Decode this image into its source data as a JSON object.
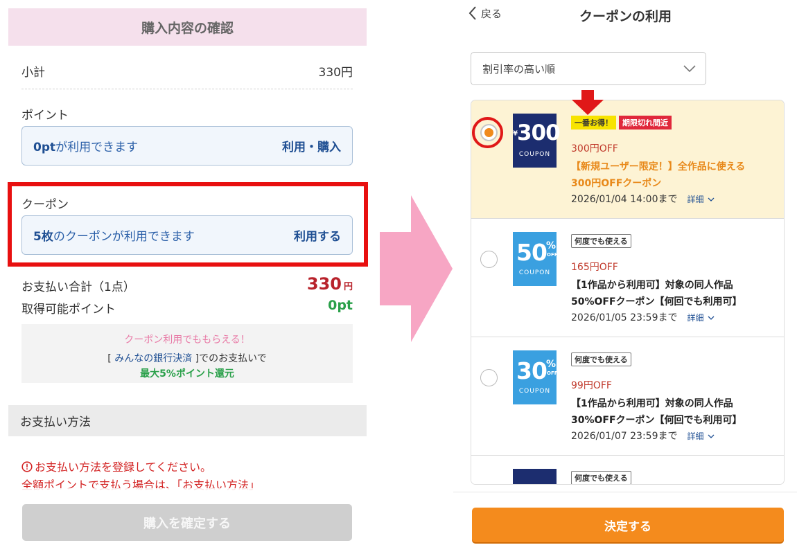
{
  "left": {
    "header_title": "購入内容の確認",
    "subtotal_label": "小計",
    "subtotal_value": "330円",
    "points_label": "ポイント",
    "points_box": {
      "amount": "0pt",
      "text": "が利用できます",
      "action": "利用・購入"
    },
    "coupon_label": "クーポン",
    "coupon_box": {
      "amount": "5枚",
      "text": "のクーポンが利用できます",
      "action": "利用する"
    },
    "total_label": "お支払い合計（1点）",
    "total_value": "330",
    "total_unit": "円",
    "earn_label": "取得可能ポイント",
    "earn_value": "0pt",
    "promo": {
      "line1": "クーポン利用でももらえる！",
      "line2_pre": "[ ",
      "line2_link": "みんなの銀行決済",
      "line2_post": " ]でのお支払いで",
      "line3": "最大5%ポイント還元"
    },
    "payment_method_label": "お支払い方法",
    "warning_line1": "お支払い方法を登録してください。",
    "warning_line2": "全額ポイントで支払う場合は、「お支払い方法」",
    "confirm_button": "購入を確定する"
  },
  "right": {
    "back_label": "戻る",
    "title": "クーポンの利用",
    "sort_selected": "割引率の高い順",
    "coupons": [
      {
        "selected": true,
        "image": {
          "style": "navy",
          "yen": "¥",
          "amount": "300",
          "word": "COUPON"
        },
        "badges": [
          {
            "type": "yellow",
            "text": "一番お得！"
          },
          {
            "type": "red",
            "text": "期限切れ間近"
          }
        ],
        "discount": "300円OFF",
        "desc1": "【新規ユーザー限定！】全作品に使える",
        "desc2": "300円OFFクーポン",
        "expiry": "2026/01/04 14:00まで",
        "detail": "詳細"
      },
      {
        "selected": false,
        "image": {
          "style": "blue",
          "percent": "50",
          "pct": "%",
          "off": "OFF",
          "word": "COUPON"
        },
        "badges": [
          {
            "type": "outline",
            "text": "何度でも使える"
          }
        ],
        "discount": "165円OFF",
        "desc1": "【1作品から利用可】対象の同人作品",
        "desc2": "50%OFFクーポン【何回でも利用可】",
        "expiry": "2026/01/05 23:59まで",
        "detail": "詳細"
      },
      {
        "selected": false,
        "image": {
          "style": "blue",
          "percent": "30",
          "pct": "%",
          "off": "OFF",
          "word": "COUPON"
        },
        "badges": [
          {
            "type": "outline",
            "text": "何度でも使える"
          }
        ],
        "discount": "99円OFF",
        "desc1": "【1作品から利用可】対象の同人作品",
        "desc2": "30%OFFクーポン【何回でも利用可】",
        "expiry": "2026/01/07 23:59まで",
        "detail": "詳細"
      },
      {
        "selected": false,
        "image": {
          "style": "navy"
        },
        "badges": [
          {
            "type": "outline",
            "text": "何度でも使える"
          }
        ]
      }
    ],
    "decide_button": "決定する"
  },
  "colors": {
    "header_pink": "#f5e0ec",
    "highlight_red": "#e81010",
    "price_red": "#b8222b",
    "point_green": "#2aa04a",
    "link_blue": "#1f4f93",
    "accent_orange": "#f48b1d",
    "selected_card_bg": "#fdf3d4",
    "coupon_navy": "#1c2d6f",
    "coupon_blue": "#3aa0e0",
    "arrow_pink": "#f7a6c4"
  }
}
